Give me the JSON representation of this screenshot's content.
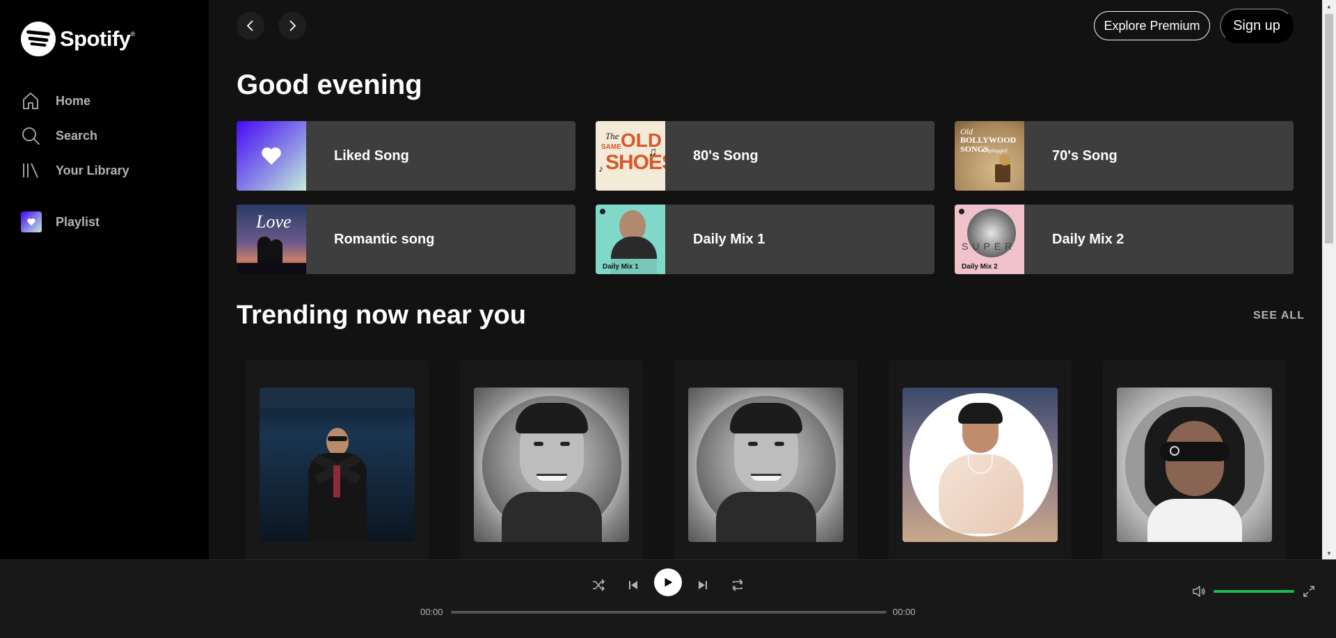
{
  "app": {
    "name": "Spotify",
    "trademark": "®"
  },
  "sidebar": {
    "items": [
      {
        "label": "Home",
        "icon": "home-icon"
      },
      {
        "label": "Search",
        "icon": "search-icon"
      },
      {
        "label": "Your Library",
        "icon": "library-icon"
      }
    ],
    "playlist": {
      "label": "Playlist",
      "icon": "heart-icon"
    }
  },
  "header": {
    "premium_label": "Explore Premium",
    "signup_label": "Sign up"
  },
  "greeting": "Good evening",
  "quick_picks": [
    {
      "label": "Liked Song"
    },
    {
      "label": "80's Song"
    },
    {
      "label": "70's Song"
    },
    {
      "label": "Romantic song"
    },
    {
      "label": "Daily Mix 1"
    },
    {
      "label": "Daily Mix 2"
    }
  ],
  "tile_art_text": {
    "eighties": [
      "The",
      "SAME",
      "OLD",
      "SHOES"
    ],
    "seventies": [
      "Old",
      "BOLLYWOOD",
      "SONGS",
      "Unplugged"
    ],
    "romantic": "Love",
    "mix1": "Daily Mix 1",
    "mix2": "Daily Mix 2",
    "mix2_word": "SUPER"
  },
  "trending": {
    "title": "Trending now near you",
    "see_all": "SEE ALL",
    "cards": 5
  },
  "player": {
    "current_time": "00:00",
    "total_time": "00:00",
    "progress": 0,
    "volume": 1.0
  },
  "colors": {
    "accent": "#1db954",
    "tile_bg": "#3e3e3e",
    "card_bg": "#181818",
    "sidebar_bg": "#000000"
  }
}
